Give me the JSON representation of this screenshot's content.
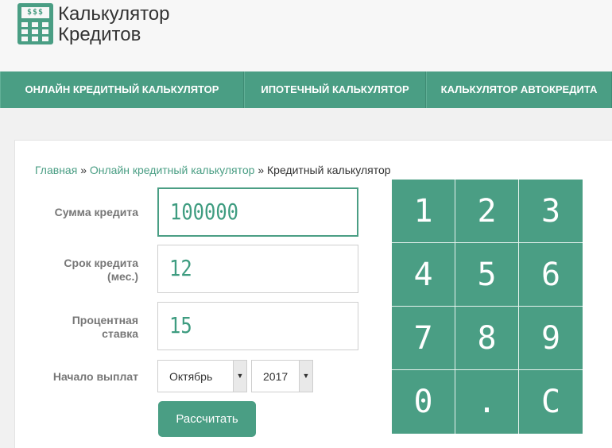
{
  "logo": {
    "screen": "$$$",
    "line1": "Калькулятор",
    "line2": "Кредитов"
  },
  "nav": [
    "ОНЛАЙН КРЕДИТНЫЙ КАЛЬКУЛЯТОР",
    "ИПОТЕЧНЫЙ КАЛЬКУЛЯТОР",
    "КАЛЬКУЛЯТОР АВТОКРЕДИТА"
  ],
  "breadcrumb": {
    "home": "Главная",
    "sep": "»",
    "section": "Онлайн кредитный калькулятор",
    "current": "Кредитный калькулятор"
  },
  "form": {
    "amount_label": "Сумма кредита",
    "amount_value": "100000",
    "term_label_1": "Срок кредита",
    "term_label_2": "(мес.)",
    "term_value": "12",
    "rate_label_1": "Процентная",
    "rate_label_2": "ставка",
    "rate_value": "15",
    "start_label": "Начало выплат",
    "month": "Октябрь",
    "year": "2017",
    "submit": "Рассчитать"
  },
  "keypad": [
    "1",
    "2",
    "3",
    "4",
    "5",
    "6",
    "7",
    "8",
    "9",
    "0",
    ".",
    "C"
  ],
  "colors": {
    "accent": "#4a9e84",
    "digit": "#3e9c80"
  },
  "icons": {
    "logo": "calculator-icon",
    "select_arrow": "chevron-down-icon"
  }
}
